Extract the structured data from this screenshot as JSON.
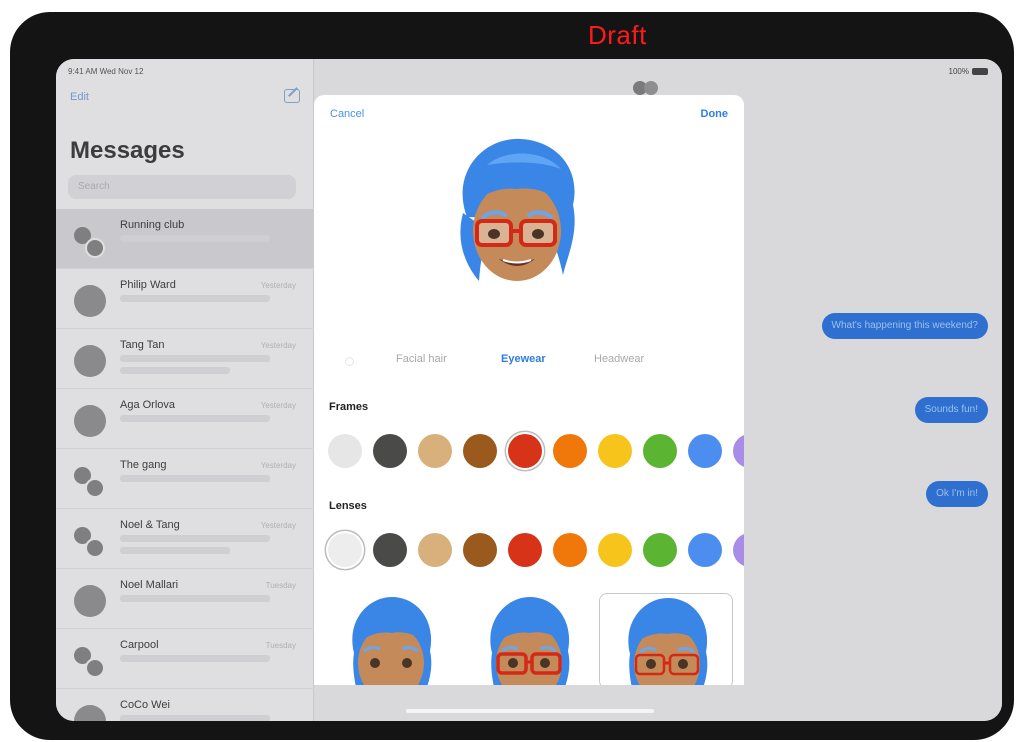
{
  "watermark": "Draft",
  "status_bar": {
    "time": "9:41 AM  Wed Nov 12",
    "battery": "100%"
  },
  "sidebar": {
    "edit_label": "Edit",
    "title": "Messages",
    "search_placeholder": "Search",
    "conversations": [
      {
        "name": "Running club",
        "time": "",
        "type": "group",
        "selected": true
      },
      {
        "name": "Philip Ward",
        "time": "Yesterday",
        "type": "single"
      },
      {
        "name": "Tang Tan",
        "time": "Yesterday",
        "type": "single"
      },
      {
        "name": "Aga Orlova",
        "time": "Yesterday",
        "type": "single"
      },
      {
        "name": "The gang",
        "time": "Yesterday",
        "type": "group"
      },
      {
        "name": "Noel & Tang",
        "time": "Yesterday",
        "type": "group"
      },
      {
        "name": "Noel Mallari",
        "time": "Tuesday",
        "type": "single"
      },
      {
        "name": "Carpool",
        "time": "Tuesday",
        "type": "group"
      },
      {
        "name": "CoCo Wei",
        "time": "",
        "type": "single"
      }
    ]
  },
  "conversation": {
    "bubbles": [
      {
        "text": "What's happening this weekend?"
      },
      {
        "text": "Sounds fun!"
      },
      {
        "text": "Ok I'm in!"
      }
    ]
  },
  "sheet": {
    "cancel_label": "Cancel",
    "done_label": "Done",
    "tabs": [
      {
        "label": "Facial hair",
        "active": false
      },
      {
        "label": "Eyewear",
        "active": true
      },
      {
        "label": "Headwear",
        "active": false
      }
    ],
    "frames_label": "Frames",
    "lenses_label": "Lenses",
    "frame_colors": [
      "#e6e6e6",
      "#4a4a48",
      "#d8b07c",
      "#9a5a1e",
      "#d63318",
      "#f0780a",
      "#f7c41c",
      "#5cb532",
      "#4b8ef0",
      "#a98ce8"
    ],
    "frame_selected_index": 4,
    "lens_colors": [
      "#ededed",
      "#4a4a48",
      "#d8b07c",
      "#9a5a1e",
      "#d63318",
      "#f0780a",
      "#f7c41c",
      "#5cb532",
      "#4b8ef0",
      "#a98ce8"
    ],
    "lens_selected_index": 0,
    "previews": [
      {
        "style": "no-glasses",
        "selected": false
      },
      {
        "style": "red-glasses",
        "selected": false
      },
      {
        "style": "red-glasses-thin",
        "selected": true
      }
    ]
  },
  "colors": {
    "accent": "#2f7de0",
    "hair": "#3a86e6",
    "skin": "#c58a5a",
    "glasses": "#d32a18"
  }
}
